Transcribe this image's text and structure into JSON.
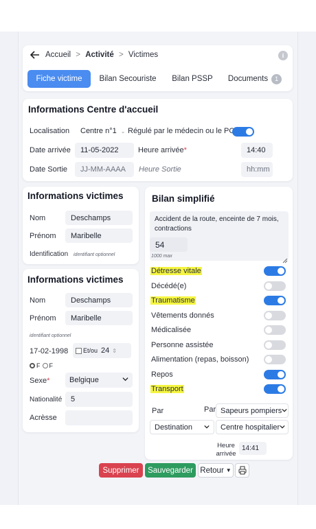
{
  "breadcrumb": {
    "home": "Accueil",
    "sep1": ">",
    "current": "Activité",
    "sep2": ">",
    "last": "Victimes"
  },
  "tabs": [
    {
      "label": "Fiche victime"
    },
    {
      "label": "Bilan Secouriste"
    },
    {
      "label": "Bilan PSSP"
    },
    {
      "label": "Documents",
      "badge": "1"
    }
  ],
  "centre": {
    "title": "Informations Centre d'accueil",
    "localisation_label": "Localisation",
    "localisation_value": "Centre n°1",
    "regule_label": "Régulé par le médecin ou le PC",
    "date_arrivee_label": "Date arrivée",
    "date_arrivee_value": "11-05-2022",
    "heure_arrivee_label": "Heure arrivée",
    "heure_arrivee_value": "14:40",
    "date_sortie_label": "Date Sortie",
    "date_sortie_placeholder": "JJ-MM-AAAA",
    "heure_sortie_placeholder": "Heure Sortie",
    "heure_sortie_value_ph": "hh:mm"
  },
  "victime1": {
    "title": "Informations victimes",
    "nom_label": "Nom",
    "nom_value": "Deschamps",
    "prenom_label": "Prénom",
    "prenom_value": "Maribelle",
    "identification_label": "Identification",
    "identification_ph": "identifiant optionnel"
  },
  "victime2": {
    "title": "Informations victimes",
    "nom_label": "Nom",
    "nom_value": "Deschamps",
    "prenom_label": "Prénom",
    "prenom_value": "Maribelle",
    "identifiant_ph": "identifiant optionnel",
    "dob_value": "17-02-1998",
    "age_check_label": "Et/ou",
    "age_value": "24",
    "sexe_opt1": "F",
    "sexe_opt2": "F",
    "sexe_label": "Sexe",
    "sexe_select": "Belgique",
    "nationalite_label": "Nationalité",
    "nationalite_value": "5",
    "adresse_label": "Acrèsse"
  },
  "bilan": {
    "title": "Bilan simplifié",
    "note": "Accident de la route, enceinte de 7 mois, contractions",
    "number": "54",
    "counter": "1000 max",
    "rows": [
      {
        "label": "Détresse vitale",
        "on": true,
        "highlight": true
      },
      {
        "label": "Décédé(e)",
        "on": false,
        "highlight": false
      },
      {
        "label": "Traumatisme",
        "on": true,
        "highlight": true
      },
      {
        "label": "Vêtements donnés",
        "on": false,
        "highlight": false
      },
      {
        "label": "Médicalisée",
        "on": false,
        "highlight": false
      },
      {
        "label": "Personne assistée",
        "on": false,
        "highlight": false
      },
      {
        "label": "Alimentation (repas, boisson)",
        "on": false,
        "highlight": false
      },
      {
        "label": "Repos",
        "on": true,
        "highlight": false
      },
      {
        "label": "Transport",
        "on": true,
        "highlight": true
      }
    ],
    "par_label1": "Par",
    "par_label2": "Par",
    "par_select": "Sapeurs pompiers",
    "destination_select": "Destination",
    "centre_select": "Centre hospitalier",
    "heure_label": "Heure arrivée",
    "heure_value": "14:41"
  },
  "actions": {
    "delete": "Supprimer",
    "save": "Sauvegarder",
    "back": "Retour"
  },
  "colors": {
    "primary": "#4a8cf0",
    "toggle_on": "#2c7be5",
    "danger": "#d9424f",
    "success": "#2e9b5f",
    "highlight": "#f5f542"
  }
}
